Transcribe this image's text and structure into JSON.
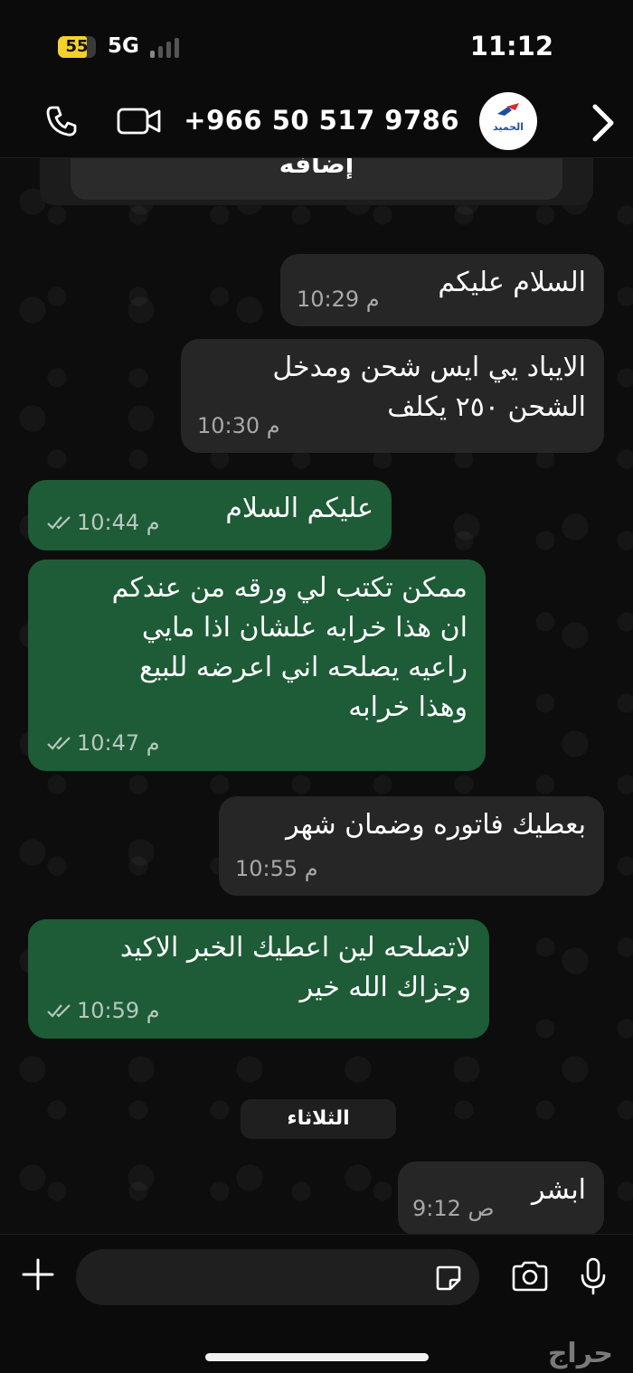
{
  "status_bar": {
    "battery": "55",
    "network": "5G",
    "time": "11:12"
  },
  "header": {
    "contact_number": "+966 50 517 9786",
    "avatar_text": "الحميد",
    "icons": [
      "phone-icon",
      "video-icon",
      "back-chevron-icon"
    ]
  },
  "system_card": {
    "label": "إضافه"
  },
  "messages": [
    {
      "dir": "in",
      "lines": [
        "السلام عليكم"
      ],
      "time": "10:29 م"
    },
    {
      "dir": "in",
      "lines": [
        "الايباد يي ايس شحن ومدخل",
        "الشحن ٢٥٠ يكلف"
      ],
      "time": "10:30 م"
    },
    {
      "dir": "out",
      "lines": [
        "عليكم السلام"
      ],
      "time": "10:44 م"
    },
    {
      "dir": "out",
      "lines": [
        "ممكن تكتب لي ورقه من عندكم",
        "ان هذا خرابه علشان اذا مايي",
        "راعيه يصلحه اني اعرضه للبيع",
        "وهذا خرابه"
      ],
      "time": "10:47 م"
    },
    {
      "dir": "in",
      "lines": [
        "بعطيك فاتوره وضمان شهر"
      ],
      "time": "10:55 م"
    },
    {
      "dir": "out",
      "lines": [
        "لاتصلحه لين اعطيك الخبر الاكيد",
        "وجزاك الله خير"
      ],
      "time": "10:59 م"
    },
    {
      "dir": "in",
      "lines": [
        "ابشر"
      ],
      "time": "9:12 ص"
    }
  ],
  "day_separator": "الثلاثاء",
  "input_bar": {
    "icons": [
      "plus-icon",
      "sticker-icon",
      "camera-icon",
      "microphone-icon"
    ]
  },
  "watermark": "حراج",
  "colors": {
    "incoming": "#262626",
    "outgoing": "#1e5b37",
    "background": "#0b0b0b"
  }
}
